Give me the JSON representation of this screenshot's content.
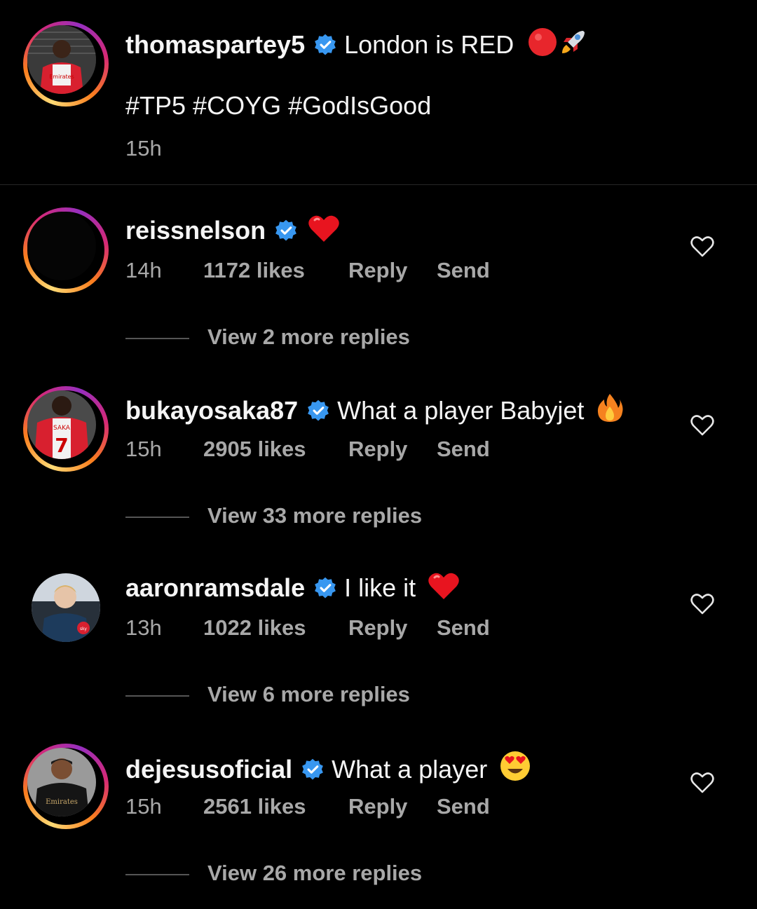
{
  "post": {
    "username": "thomaspartey5",
    "caption": "London is RED",
    "hashtags": "#TP5 #COYG #GodIsGood",
    "time": "15h"
  },
  "comments": [
    {
      "username": "reissnelson",
      "text": "",
      "time": "14h",
      "likes": "1172 likes",
      "reply": "Reply",
      "send": "Send",
      "view_replies": "View 2 more replies"
    },
    {
      "username": "bukayosaka87",
      "text": "What a player Babyjet",
      "time": "15h",
      "likes": "2905 likes",
      "reply": "Reply",
      "send": "Send",
      "view_replies": "View 33 more replies"
    },
    {
      "username": "aaronramsdale",
      "text": "I like it",
      "time": "13h",
      "likes": "1022 likes",
      "reply": "Reply",
      "send": "Send",
      "view_replies": "View 6 more replies"
    },
    {
      "username": "dejesusoficial",
      "text": "What a player",
      "time": "15h",
      "likes": "2561 likes",
      "reply": "Reply",
      "send": "Send",
      "view_replies": "View 26 more replies"
    }
  ],
  "icons": {
    "verified": "verified-badge-icon",
    "like": "heart-outline-icon"
  },
  "colors": {
    "background": "#000000",
    "verified": "#3897f0",
    "secondary_text": "#a8a8a8",
    "story_ring": "#d62976"
  }
}
